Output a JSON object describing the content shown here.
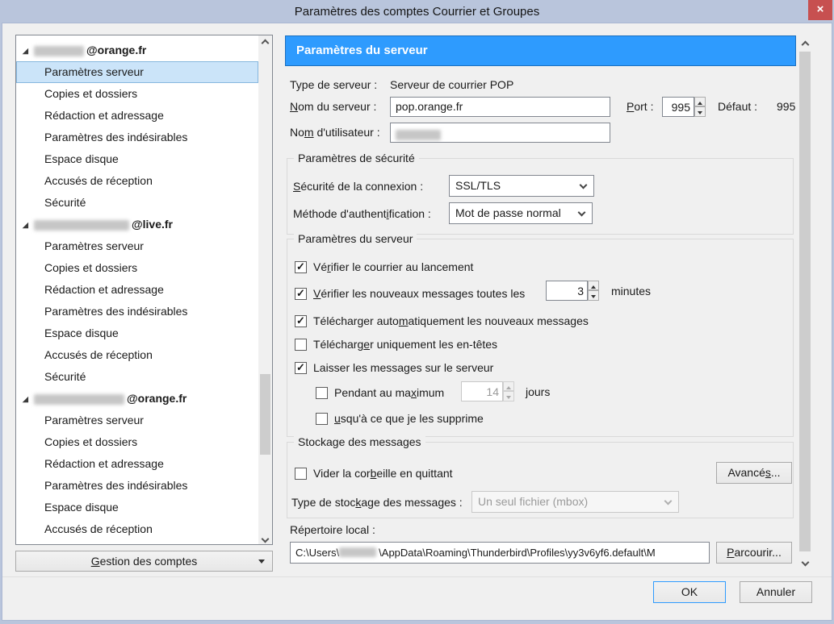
{
  "colors": {
    "titlebar-bg": "#b9c5dc",
    "dialog-bg": "#f0f0f0",
    "accent-blue": "#2e9bfe",
    "accent-blue-border": "#1b6fbf",
    "close-red": "#c75050",
    "selection-bg": "#cbe4f9",
    "selection-border": "#86b7de"
  },
  "icons": {
    "close": "×",
    "expander": "◢",
    "check": "✓"
  },
  "window": {
    "title": "Paramètres des comptes Courrier et Groupes"
  },
  "sidebar": {
    "accounts": [
      {
        "name": "@orange.fr",
        "items": [
          "Paramètres serveur",
          "Copies et dossiers",
          "Rédaction et adressage",
          "Paramètres des indésirables",
          "Espace disque",
          "Accusés de réception",
          "Sécurité"
        ]
      },
      {
        "name": "@live.fr",
        "items": [
          "Paramètres serveur",
          "Copies et dossiers",
          "Rédaction et adressage",
          "Paramètres des indésirables",
          "Espace disque",
          "Accusés de réception",
          "Sécurité"
        ]
      },
      {
        "name": "@orange.fr",
        "items": [
          "Paramètres serveur",
          "Copies et dossiers",
          "Rédaction et adressage",
          "Paramètres des indésirables",
          "Espace disque",
          "Accusés de réception"
        ]
      }
    ],
    "manage_accounts": {
      "pre": "",
      "key": "G",
      "post": "estion des comptes"
    }
  },
  "main": {
    "header": "Paramètres du serveur",
    "server_type": {
      "label": "Type de serveur :",
      "value": "Serveur de courrier POP"
    },
    "server_name": {
      "label": {
        "pre": "",
        "key": "N",
        "post": "om du serveur :"
      },
      "value": "pop.orange.fr"
    },
    "port": {
      "label": {
        "pre": "",
        "key": "P",
        "post": "ort :"
      },
      "value": "995",
      "default_label": "Défaut :",
      "default_value": "995"
    },
    "username": {
      "label": {
        "pre": "No",
        "key": "m",
        "post": " d'utilisateur :"
      }
    },
    "security": {
      "legend": "Paramètres de sécurité",
      "connection": {
        "label": {
          "pre": "",
          "key": "S",
          "post": "écurité de la connexion :"
        },
        "value": "SSL/TLS"
      },
      "auth": {
        "label": {
          "pre": "Méthode d'authent",
          "key": "i",
          "post": "fication :"
        },
        "value": "Mot de passe normal"
      }
    },
    "server_settings": {
      "legend": "Paramètres du serveur",
      "check_on_startup": {
        "checked": true,
        "label": {
          "pre": "Vé",
          "key": "r",
          "post": "ifier le courrier au lancement"
        }
      },
      "check_interval": {
        "checked": true,
        "label": {
          "pre": "",
          "key": "V",
          "post": "érifier les nouveaux messages toutes les"
        },
        "value": "3",
        "unit": "minutes"
      },
      "auto_download": {
        "checked": true,
        "label": {
          "pre": "Télécharger auto",
          "key": "m",
          "post": "atiquement les nouveaux messages"
        }
      },
      "headers_only": {
        "checked": false,
        "label": {
          "pre": "Télécharg",
          "key": "e",
          "post": "r uniquement les en-têtes"
        }
      },
      "leave_on_server": {
        "checked": true,
        "label": {
          "pre": "Laisser les messa",
          "key": "g",
          "post": "es sur le serveur"
        }
      },
      "max_days": {
        "checked": false,
        "label": {
          "pre": "Pendant au ma",
          "key": "x",
          "post": "imum"
        },
        "value": "14",
        "unit": "jours"
      },
      "until_deleted": {
        "checked": false,
        "label": {
          "pre": "J",
          "key": "u",
          "post": "squ'à ce que je les supprime"
        }
      }
    },
    "storage": {
      "legend": "Stockage des messages",
      "empty_trash": {
        "checked": false,
        "label": {
          "pre": "Vider la cor",
          "key": "b",
          "post": "eille en quittant"
        }
      },
      "advanced_button": {
        "pre": "Avancé",
        "key": "s",
        "post": "..."
      },
      "storage_type": {
        "label": {
          "pre": "Type de stoc",
          "key": "k",
          "post": "age des messages :"
        },
        "value": "Un seul fichier (mbox)"
      }
    },
    "local_dir": {
      "label": "Répertoire local :",
      "path_prefix": "C:\\Users\\",
      "path_suffix": "\\AppData\\Roaming\\Thunderbird\\Profiles\\yy3v6yf6.default\\M",
      "browse_button": {
        "pre": "",
        "key": "P",
        "post": "arcourir..."
      }
    }
  },
  "footer": {
    "ok": "OK",
    "cancel": "Annuler"
  }
}
